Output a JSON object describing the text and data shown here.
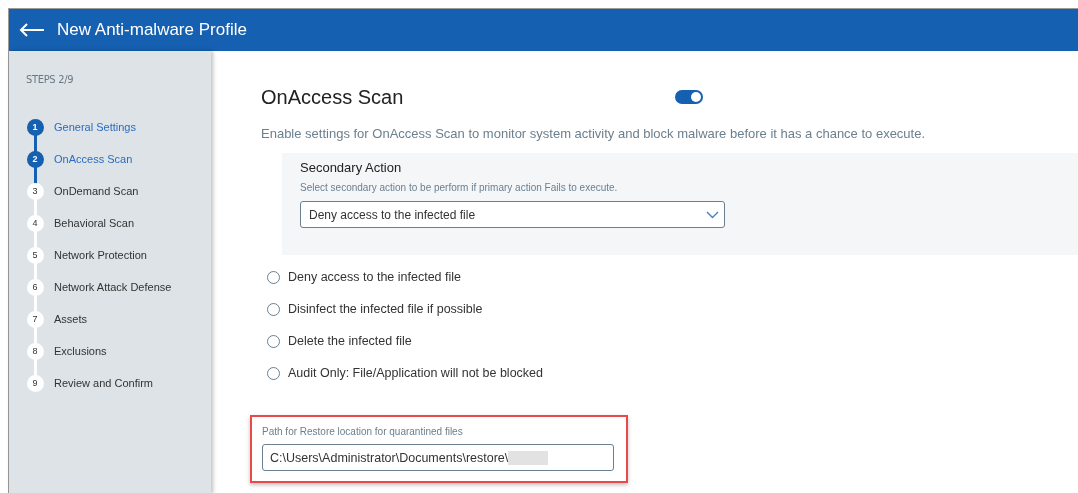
{
  "header": {
    "back_icon": true,
    "title": "New Anti-malware Profile"
  },
  "sidebar": {
    "heading": "STEPS 2/9",
    "steps": [
      {
        "number": "1",
        "label": "General Settings",
        "done": true
      },
      {
        "number": "2",
        "label": "OnAccess Scan",
        "done": true
      },
      {
        "number": "3",
        "label": "OnDemand Scan",
        "done": false
      },
      {
        "number": "4",
        "label": "Behavioral Scan",
        "done": false
      },
      {
        "number": "5",
        "label": "Network Protection",
        "done": false
      },
      {
        "number": "6",
        "label": "Network Attack Defense",
        "done": false
      },
      {
        "number": "7",
        "label": "Assets",
        "done": false
      },
      {
        "number": "8",
        "label": "Exclusions",
        "done": false
      },
      {
        "number": "9",
        "label": "Review and Confirm",
        "done": false
      }
    ]
  },
  "section": {
    "title": "OnAccess Scan",
    "enabled": true,
    "description": "Enable settings for OnAccess Scan to monitor system activity and block malware before it has a chance to execute."
  },
  "secondary_action": {
    "label": "Secondary Action",
    "hint": "Select secondary action to be perform if primary action Fails to execute.",
    "value": "Deny access to the infected file"
  },
  "options": [
    {
      "label": "Deny access to the infected file",
      "selected": false
    },
    {
      "label": "Disinfect the infected file if possible",
      "selected": false
    },
    {
      "label": "Delete the infected file",
      "selected": false
    },
    {
      "label": "Audit Only: File/Application will not be blocked",
      "selected": false
    }
  ],
  "restore_path": {
    "label": "Path for Restore location for quarantined files",
    "value": "C:\\Users\\Administrator\\Documents\\restore\\",
    "redacted": true,
    "highlighted": true
  }
}
